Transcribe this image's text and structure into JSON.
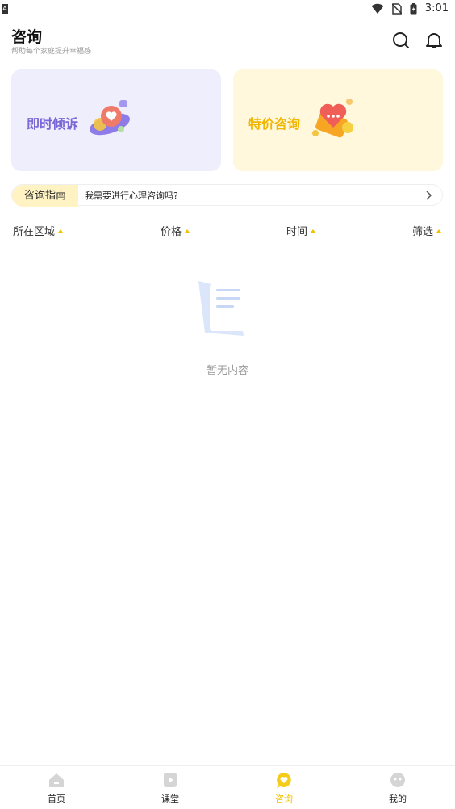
{
  "status_bar": {
    "time": "3:01"
  },
  "header": {
    "title": "咨询",
    "subtitle": "帮助每个家庭提升幸福感"
  },
  "cards": [
    {
      "label": "即时倾诉",
      "color": "#7b67d6",
      "bg": "#efeefd"
    },
    {
      "label": "特价咨询",
      "color": "#f2b600",
      "bg": "#fff8dc"
    }
  ],
  "guide": {
    "tag": "咨询指南",
    "text": "我需要进行心理咨询吗?"
  },
  "filters": [
    "所在区域",
    "价格",
    "时间",
    "筛选"
  ],
  "empty": {
    "text": "暂无内容"
  },
  "tabs": [
    {
      "label": "首页",
      "icon": "home-icon"
    },
    {
      "label": "课堂",
      "icon": "play-icon"
    },
    {
      "label": "咨询",
      "icon": "consult-icon",
      "active": true
    },
    {
      "label": "我的",
      "icon": "profile-icon"
    }
  ],
  "colors": {
    "accent": "#f2c200",
    "purple": "#7b67d6"
  }
}
